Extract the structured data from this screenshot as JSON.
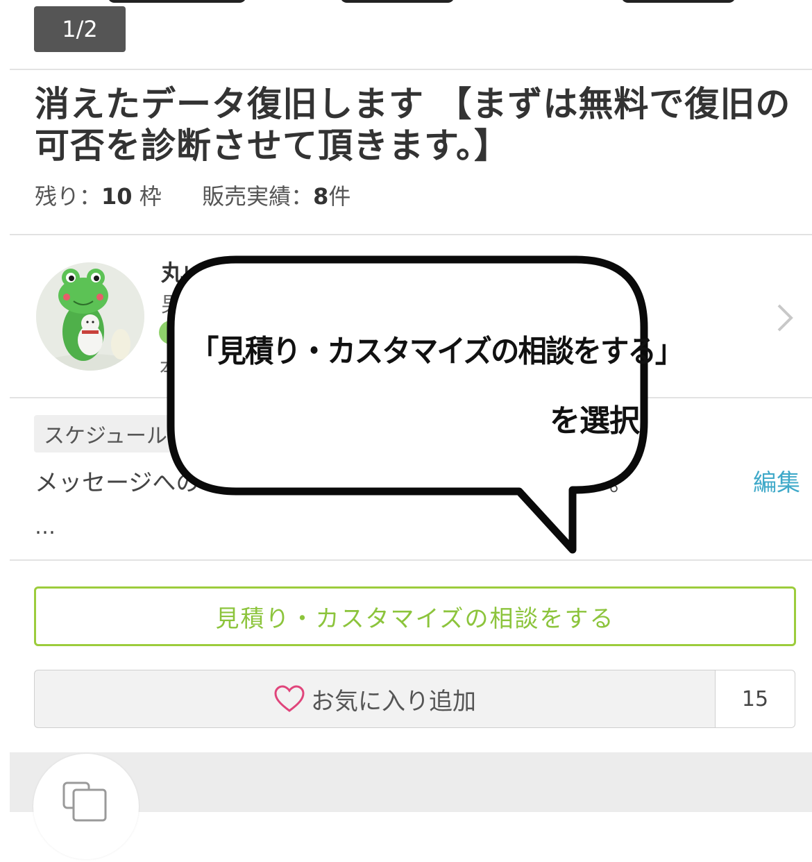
{
  "gallery": {
    "counter": "1/2"
  },
  "service": {
    "title_line1": "消えたデータ復旧します 【まずは無料で復旧の",
    "title_line2": "可否を診断させて頂きます。】",
    "remaining_label": "残り：",
    "remaining_value": "10",
    "remaining_unit": "枠",
    "sales_label": "販売実績：",
    "sales_value": "8",
    "sales_unit": "件"
  },
  "seller": {
    "name": "丸山",
    "sub": "男",
    "sub2": "本",
    "status_color": "#8fd16b"
  },
  "schedule": {
    "tag": "スケジュール",
    "message": "メッセージへの",
    "message_tail": "。",
    "edit": "編集",
    "ellipsis": "…"
  },
  "bubble": {
    "line1": "「見積り・カスタマイズの相談をする」",
    "line2": "を選択"
  },
  "actions": {
    "consult_label": "見積り・カスタマイズの相談をする",
    "favorite_label": "お気に入り追加",
    "favorite_count": "15",
    "accent_color": "#9ccc3c",
    "heart_color": "#e0457b"
  }
}
